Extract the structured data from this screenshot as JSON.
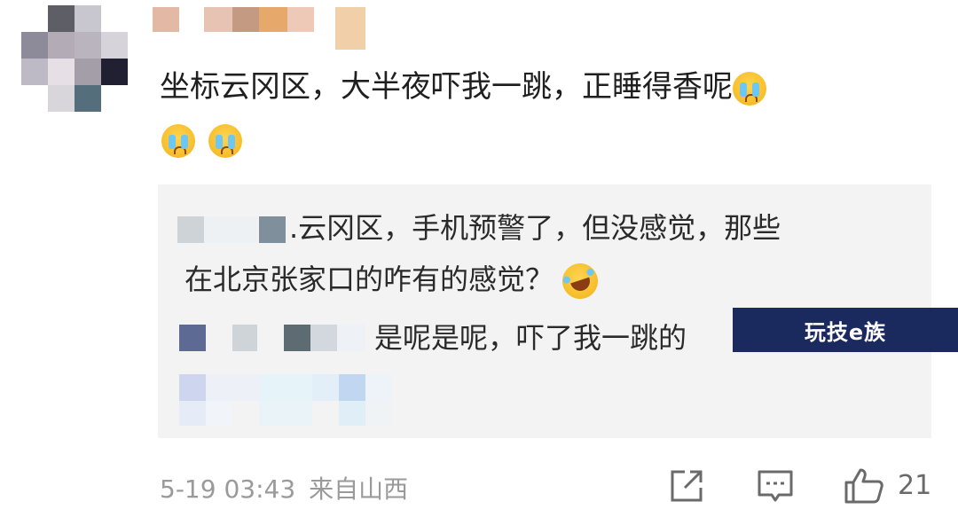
{
  "comment": {
    "text_line1": "坐标云冈区，大半夜吓我一跳，正睡得香呢",
    "emoji_name": "crying-face-icon"
  },
  "reply_box": {
    "reply1_separator": ".",
    "reply1_line1": "云冈区，手机预警了，但没感觉，那些",
    "reply1_line2": "在北京张家口的咋有的感觉？",
    "reply2_text": "是呢是呢，吓了我一跳的"
  },
  "watermark": {
    "label": "玩技e族"
  },
  "footer": {
    "date": "5-19",
    "time": "03:43",
    "location": "来自山西",
    "like_count": "21"
  },
  "colors": {
    "reply_bg": "#f3f3f3",
    "meta_gray": "#9a9a9a",
    "watermark_bg": "#1a2a5e"
  }
}
